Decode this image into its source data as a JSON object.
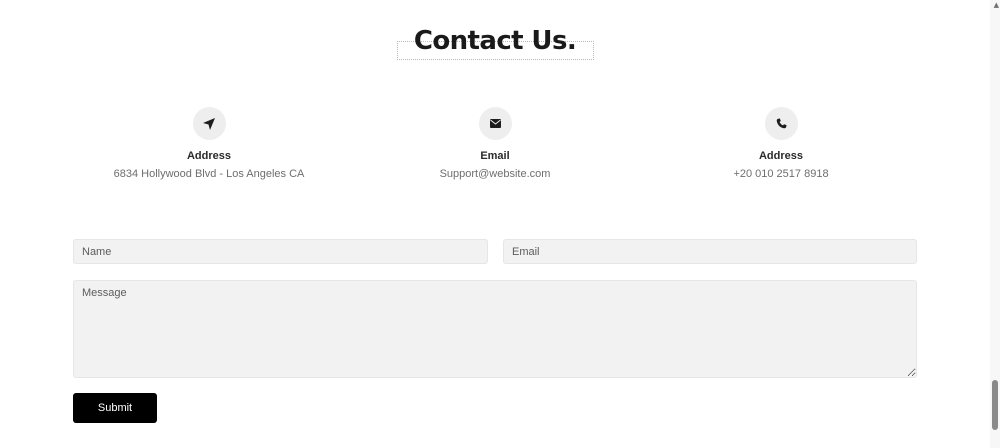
{
  "page": {
    "title": "Contact Us."
  },
  "contact_info": [
    {
      "icon": "location-arrow-icon",
      "label": "Address",
      "value": "6834 Hollywood Blvd - Los Angeles CA"
    },
    {
      "icon": "envelope-icon",
      "label": "Email",
      "value": "Support@website.com"
    },
    {
      "icon": "phone-icon",
      "label": "Address",
      "value": "+20 010 2517 8918"
    }
  ],
  "form": {
    "name_placeholder": "Name",
    "email_placeholder": "Email",
    "message_placeholder": "Message",
    "submit_label": "Submit"
  },
  "colors": {
    "accent": "#000000",
    "field_bg": "#f2f2f2",
    "icon_circle_bg": "#eeeeee"
  }
}
